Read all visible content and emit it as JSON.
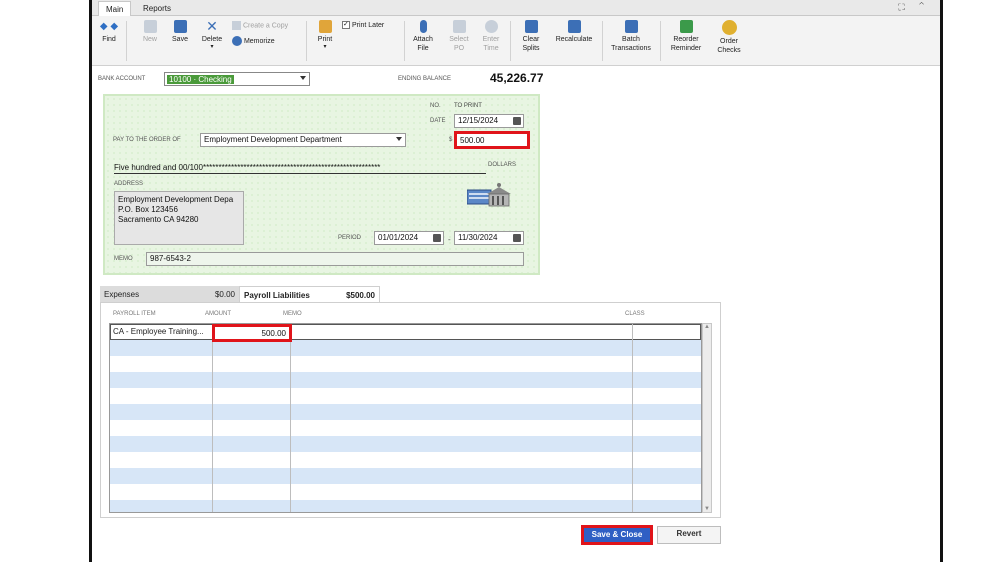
{
  "tabs": {
    "main": "Main",
    "reports": "Reports"
  },
  "window_controls": "⛶ ⌃",
  "toolbar": {
    "find": "Find",
    "new": "New",
    "save": "Save",
    "delete": "Delete",
    "create_copy": "Create a Copy",
    "memorize": "Memorize",
    "print": "Print",
    "print_later": "Print Later",
    "attach_file": "Attach File",
    "select_po": "Select PO",
    "enter_time": "Enter Time",
    "clear_splits": "Clear Splits",
    "recalculate": "Recalculate",
    "batch_transactions": "Batch Transactions",
    "reorder_reminder": "Reorder Reminder",
    "order_checks": "Order Checks"
  },
  "header": {
    "bank_account_label": "BANK ACCOUNT",
    "bank_account_value": "10100 · Checking",
    "ending_balance_label": "ENDING BALANCE",
    "ending_balance_value": "45,226.77"
  },
  "check": {
    "no_label": "NO.",
    "no_value": "TO PRINT",
    "date_label": "DATE",
    "date_value": "12/15/2024",
    "pay_to_label": "PAY TO THE ORDER OF",
    "payee": "Employment Development Department",
    "dollar_sign": "$",
    "amount": "500.00",
    "amount_words": "Five hundred and 00/100*********************************************************",
    "dollars_label": "DOLLARS",
    "address_label": "ADDRESS",
    "address_lines": [
      "Employment Development Depa",
      "P.O. Box 123456",
      "Sacramento CA 94280"
    ],
    "period_label": "PERIOD",
    "period_from": "01/01/2024",
    "period_dash": "-",
    "period_to": "11/30/2024",
    "memo_label": "MEMO",
    "memo": "987-6543-2"
  },
  "split_tabs": {
    "expenses_label": "Expenses",
    "expenses_total": "$0.00",
    "payroll_label": "Payroll Liabilities",
    "payroll_total": "$500.00"
  },
  "grid": {
    "headers": [
      "PAYROLL ITEM",
      "AMOUNT",
      "MEMO",
      "CLASS"
    ],
    "rows": [
      {
        "payroll_item": "CA - Employee Training...",
        "amount": "500.00",
        "memo": "",
        "class": ""
      }
    ]
  },
  "buttons": {
    "save_close": "Save & Close",
    "revert": "Revert"
  },
  "colors": {
    "accent_red": "#e0141a",
    "check_green": "#e8f5e2",
    "row_blue": "#d7e6f7",
    "button_blue": "#2f5fc4"
  }
}
